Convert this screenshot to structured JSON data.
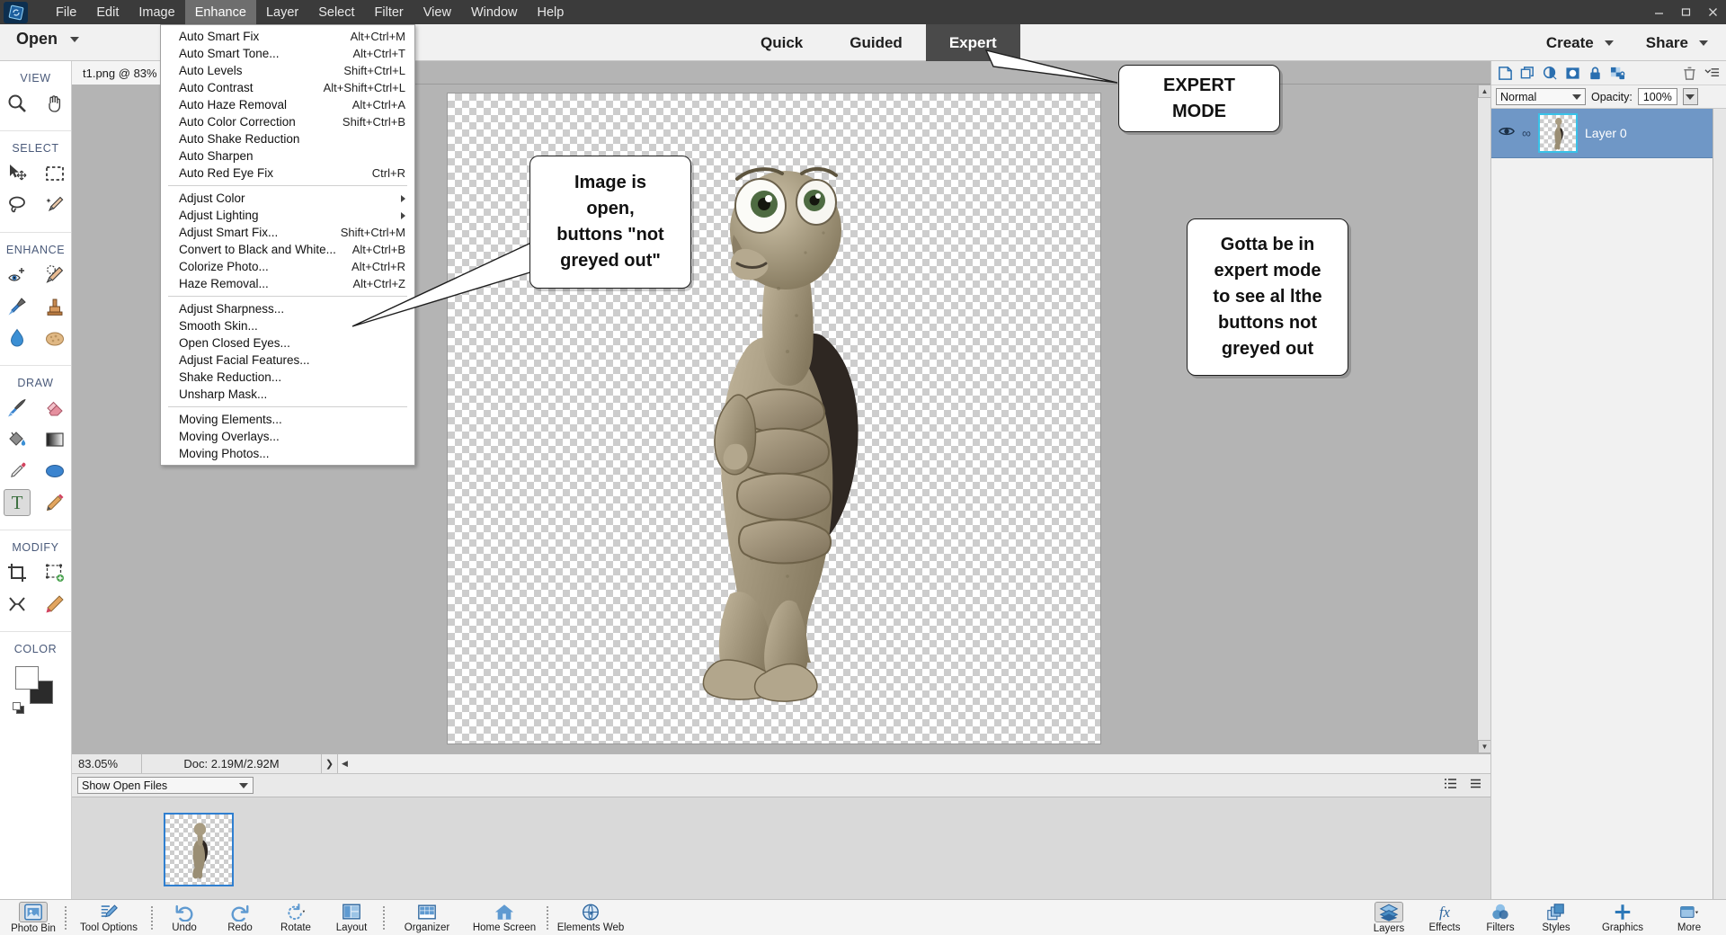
{
  "window": {
    "controls": [
      "minimize",
      "maximize",
      "close"
    ]
  },
  "menubar": {
    "items": [
      {
        "label": "File"
      },
      {
        "label": "Edit"
      },
      {
        "label": "Image"
      },
      {
        "label": "Enhance",
        "active": true
      },
      {
        "label": "Layer"
      },
      {
        "label": "Select"
      },
      {
        "label": "Filter"
      },
      {
        "label": "View"
      },
      {
        "label": "Window"
      },
      {
        "label": "Help"
      }
    ]
  },
  "topbar": {
    "open_label": "Open",
    "modes": [
      {
        "label": "Quick",
        "active": false
      },
      {
        "label": "Guided",
        "active": false
      },
      {
        "label": "Expert",
        "active": true
      }
    ],
    "create_label": "Create",
    "share_label": "Share"
  },
  "enhance_menu": {
    "groups": [
      {
        "items": [
          {
            "label": "Auto Smart Fix",
            "underline": "S",
            "shortcut": "Alt+Ctrl+M"
          },
          {
            "label": "Auto Smart Tone...",
            "underline": "e",
            "shortcut": "Alt+Ctrl+T"
          },
          {
            "label": "Auto Levels",
            "underline": "A",
            "shortcut": "Shift+Ctrl+L"
          },
          {
            "label": "Auto Contrast",
            "underline": "u",
            "shortcut": "Alt+Shift+Ctrl+L"
          },
          {
            "label": "Auto Haze Removal",
            "underline": "H",
            "shortcut": "Alt+Ctrl+A"
          },
          {
            "label": "Auto Color Correction",
            "underline": "o",
            "shortcut": "Shift+Ctrl+B"
          },
          {
            "label": "Auto Shake Reduction",
            "underline": "",
            "shortcut": ""
          },
          {
            "label": "Auto Sharpen",
            "underline": "",
            "shortcut": ""
          },
          {
            "label": "Auto Red Eye Fix",
            "underline": "R",
            "shortcut": "Ctrl+R"
          }
        ]
      },
      {
        "items": [
          {
            "label": "Adjust Color",
            "underline": "C",
            "shortcut": "",
            "submenu": true
          },
          {
            "label": "Adjust Lighting",
            "underline": "L",
            "shortcut": "",
            "submenu": true
          },
          {
            "label": "Adjust Smart Fix...",
            "underline": "m",
            "shortcut": "Shift+Ctrl+M"
          },
          {
            "label": "Convert to Black and White...",
            "underline": "",
            "shortcut": "Alt+Ctrl+B"
          },
          {
            "label": "Colorize Photo...",
            "underline": "",
            "shortcut": "Alt+Ctrl+R"
          },
          {
            "label": "Haze Removal...",
            "underline": "o",
            "shortcut": "Alt+Ctrl+Z"
          }
        ]
      },
      {
        "items": [
          {
            "label": "Adjust Sharpness...",
            "underline": "",
            "shortcut": ""
          },
          {
            "label": "Smooth Skin...",
            "underline": "",
            "shortcut": ""
          },
          {
            "label": "Open Closed Eyes...",
            "underline": "",
            "shortcut": ""
          },
          {
            "label": "Adjust Facial Features...",
            "underline": "",
            "shortcut": ""
          },
          {
            "label": "Shake Reduction...",
            "underline": "",
            "shortcut": ""
          },
          {
            "label": "Unsharp Mask...",
            "underline": "",
            "shortcut": ""
          }
        ]
      },
      {
        "items": [
          {
            "label": "Moving Elements...",
            "underline": "",
            "shortcut": ""
          },
          {
            "label": "Moving Overlays...",
            "underline": "",
            "shortcut": ""
          },
          {
            "label": "Moving Photos...",
            "underline": "",
            "shortcut": ""
          }
        ]
      }
    ]
  },
  "toolbar": {
    "groups": [
      {
        "label": "VIEW",
        "rows": [
          [
            {
              "name": "zoom-tool"
            },
            {
              "name": "hand-tool"
            }
          ]
        ]
      },
      {
        "label": "SELECT",
        "rows": [
          [
            {
              "name": "move-tool"
            },
            {
              "name": "rectangular-marquee-tool"
            }
          ],
          [
            {
              "name": "lasso-tool"
            },
            {
              "name": "quick-selection-tool"
            }
          ]
        ]
      },
      {
        "label": "ENHANCE",
        "rows": [
          [
            {
              "name": "red-eye-removal-tool"
            },
            {
              "name": "spot-healing-brush-tool"
            }
          ],
          [
            {
              "name": "smart-brush-tool"
            },
            {
              "name": "clone-stamp-tool"
            }
          ],
          [
            {
              "name": "blur-tool"
            },
            {
              "name": "sponge-tool"
            }
          ]
        ]
      },
      {
        "label": "DRAW",
        "rows": [
          [
            {
              "name": "brush-tool"
            },
            {
              "name": "eraser-tool"
            }
          ],
          [
            {
              "name": "paint-bucket-tool"
            },
            {
              "name": "gradient-tool"
            }
          ],
          [
            {
              "name": "eyedropper-tool"
            },
            {
              "name": "shape-tool"
            }
          ],
          [
            {
              "name": "type-tool",
              "selected": true
            },
            {
              "name": "pencil-tool"
            }
          ]
        ]
      },
      {
        "label": "MODIFY",
        "rows": [
          [
            {
              "name": "crop-tool"
            },
            {
              "name": "recompose-tool"
            }
          ],
          [
            {
              "name": "content-aware-move-tool"
            },
            {
              "name": "straighten-tool"
            }
          ]
        ]
      },
      {
        "label": "COLOR",
        "rows": []
      }
    ]
  },
  "document": {
    "tab_label": "t1.png @ 83%",
    "zoom_label": "83.05%",
    "doc_size": "Doc: 2.19M/2.92M"
  },
  "photobin": {
    "select_label": "Show Open Files"
  },
  "layers_panel": {
    "icons": [
      "new-layer-icon",
      "duplicate-layer-icon",
      "adjustment-layer-icon",
      "layer-mask-icon",
      "lock-icon",
      "lock-transparency-icon",
      "delete-layer-icon",
      "panel-menu-icon"
    ],
    "blend_mode": "Normal",
    "opacity_label": "Opacity:",
    "opacity_value": "100%",
    "layers": [
      {
        "name": "Layer 0",
        "visible": true,
        "selected": true
      }
    ]
  },
  "taskbar": {
    "left_items": [
      {
        "label": "Photo Bin",
        "icon": "photo-bin-icon",
        "selected": true
      },
      {
        "label": "Tool Options",
        "icon": "tool-options-icon"
      },
      {
        "label": "Undo",
        "icon": "undo-icon"
      },
      {
        "label": "Redo",
        "icon": "redo-icon"
      },
      {
        "label": "Rotate",
        "icon": "rotate-icon",
        "caret": true
      },
      {
        "label": "Layout",
        "icon": "layout-icon",
        "caret": true
      },
      {
        "label": "Organizer",
        "icon": "organizer-icon"
      },
      {
        "label": "Home Screen",
        "icon": "home-icon"
      },
      {
        "label": "Elements Web",
        "icon": "globe-icon"
      }
    ],
    "right_items": [
      {
        "label": "Layers",
        "icon": "layers-icon",
        "selected": true
      },
      {
        "label": "Effects",
        "icon": "effects-fx-icon"
      },
      {
        "label": "Filters",
        "icon": "filters-icon"
      },
      {
        "label": "Styles",
        "icon": "styles-icon"
      },
      {
        "label": "Graphics",
        "icon": "graphics-plus-icon"
      },
      {
        "label": "More",
        "icon": "more-icon",
        "caret": true
      }
    ]
  },
  "annotations": [
    {
      "name": "callout-expert-mode",
      "text": "EXPERT\nMODE"
    },
    {
      "name": "callout-image-open",
      "text": "Image is\nopen,\nbuttons \"not\ngreyed out\""
    },
    {
      "name": "callout-expert-mode-buttons",
      "text": "Gotta be in\nexpert mode\nto see al lthe\nbuttons not\ngreyed out"
    }
  ],
  "colors": {
    "titlebar": "#3b3b3b",
    "active_tab": "#4a4a4a",
    "layer_selected": "#6f97c6",
    "canvas_bg": "#b4b4b4",
    "accent_blue": "#2f7fd0"
  }
}
